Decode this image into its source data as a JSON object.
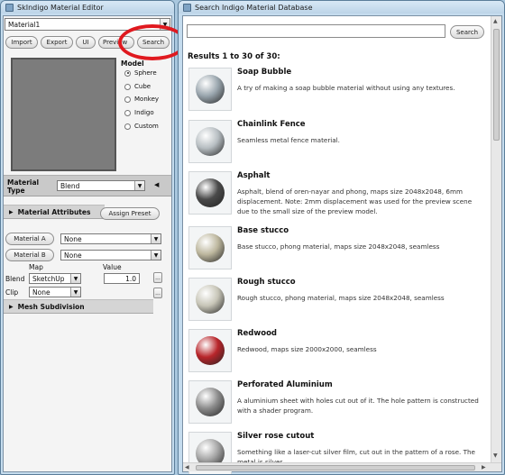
{
  "left_window": {
    "title": "SkIndigo Material Editor",
    "material_select": "Material1",
    "toolbar": [
      "Import",
      "Export",
      "UI",
      "Preview",
      "Search"
    ],
    "model_label": "Model",
    "models": [
      "Sphere",
      "Cube",
      "Monkey",
      "Indigo",
      "Custom"
    ],
    "selected_model": "Sphere",
    "material_type_label": "Material Type",
    "material_type_value": "Blend",
    "material_attributes_label": "Material Attributes",
    "assign_preset_label": "Assign Preset",
    "material_a_label": "Material A",
    "material_a_value": "None",
    "material_b_label": "Material B",
    "material_b_value": "None",
    "map_label": "Map",
    "value_label": "Value",
    "blend_label": "Blend",
    "blend_map_value": "SketchUp",
    "blend_value": "1.0",
    "clip_label": "Clip",
    "clip_value": "None",
    "ellipsis": "...",
    "mesh_subdivision_label": "Mesh Subdivision"
  },
  "right_window": {
    "title": "Search Indigo Material Database",
    "search_button": "Search",
    "search_value": "",
    "results_header": "Results 1 to 30 of 30:",
    "results": [
      {
        "title": "Soap Bubble",
        "desc": "A try of making a soap bubble material without using any textures.",
        "color": "#9aa6ae"
      },
      {
        "title": "Chainlink Fence",
        "desc": "Seamless metal fence material.",
        "color": "#b7bec2"
      },
      {
        "title": "Asphalt",
        "desc": "Asphalt, blend of oren-nayar and phong, maps size 2048x2048, 6mm displacement. Note: 2mm displacement was used for the preview scene due to the small size of the preview model.",
        "color": "#4a4a4a"
      },
      {
        "title": "Base stucco",
        "desc": "Base stucco, phong material, maps size 2048x2048, seamless",
        "color": "#bdb79e"
      },
      {
        "title": "Rough stucco",
        "desc": "Rough stucco, phong material, maps size 2048x2048, seamless",
        "color": "#c7c5b7"
      },
      {
        "title": "Redwood",
        "desc": "Redwood, maps size 2000x2000, seamless",
        "color": "#b8252a"
      },
      {
        "title": "Perforated Aluminium",
        "desc": "A aluminium sheet with holes cut out of it. The hole pattern is constructed with a shader program.",
        "color": "#8c8c8c"
      },
      {
        "title": "Silver rose cutout",
        "desc": "Something like a laser-cut silver film, cut out in the pattern of a rose. The metal is silver.",
        "color": "#a4a4a4"
      }
    ]
  },
  "colors": {
    "highlight_circle": "#e0191f",
    "title_text": "#222222",
    "accent": "#7a6f6f"
  }
}
